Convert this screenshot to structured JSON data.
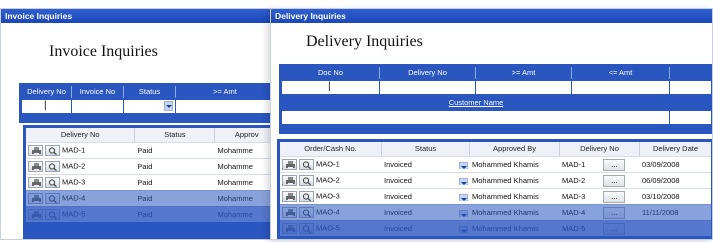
{
  "invoice_window": {
    "title": "Invoice Inquiries",
    "heading": "Invoice Inquiries",
    "criteria_headers": [
      "Delivery No",
      "Invoice No",
      "Status",
      ">= Amt"
    ],
    "grid_headers": [
      "Delivery No",
      "Status",
      "Approv"
    ],
    "rows": [
      {
        "no": "MAD-1",
        "status": "Paid",
        "approved": "Mohamme"
      },
      {
        "no": "MAD-2",
        "status": "Paid",
        "approved": "Mohamme"
      },
      {
        "no": "MAD-3",
        "status": "Paid",
        "approved": "Mohamme"
      },
      {
        "no": "MAD-4",
        "status": "Paid",
        "approved": "Mohamme"
      },
      {
        "no": "MAD-5",
        "status": "Paid",
        "approved": "Mohamme"
      }
    ]
  },
  "delivery_window": {
    "title": "Delivery Inquiries",
    "heading": "Delivery Inquiries",
    "criteria_headers": [
      "Doc No",
      "Delivery No",
      ">= Amt",
      "<= Amt"
    ],
    "customer_name_label": "Customer Name",
    "grid_headers": [
      "Order/Cash No.",
      "Status",
      "Approved By",
      "Delivery No",
      "Delivery Date"
    ],
    "ellipsis": "...",
    "rows": [
      {
        "no": "MAO-1",
        "status": "Invoiced",
        "approved": "Mohammed Khamis",
        "delivery": "MAD-1",
        "date": "03/09/2008"
      },
      {
        "no": "MAO-2",
        "status": "Invoiced",
        "approved": "Mohammed Khamis",
        "delivery": "MAD-2",
        "date": "06/09/2008"
      },
      {
        "no": "MAO-3",
        "status": "Invoiced",
        "approved": "Mohammed Khamis",
        "delivery": "MAD-3",
        "date": "03/10/2008"
      },
      {
        "no": "MAO-4",
        "status": "Invoiced",
        "approved": "Mohammed Khamis",
        "delivery": "MAD-4",
        "date": "11/11/2008"
      },
      {
        "no": "MAO-5",
        "status": "Invoiced",
        "approved": "Mohammed Khamis",
        "delivery": "MAD-5",
        "date": ""
      }
    ]
  },
  "colors": {
    "titlebar": "#1b47b8",
    "criteria_panel": "#2a56c0",
    "link": "#1b3fd0"
  }
}
